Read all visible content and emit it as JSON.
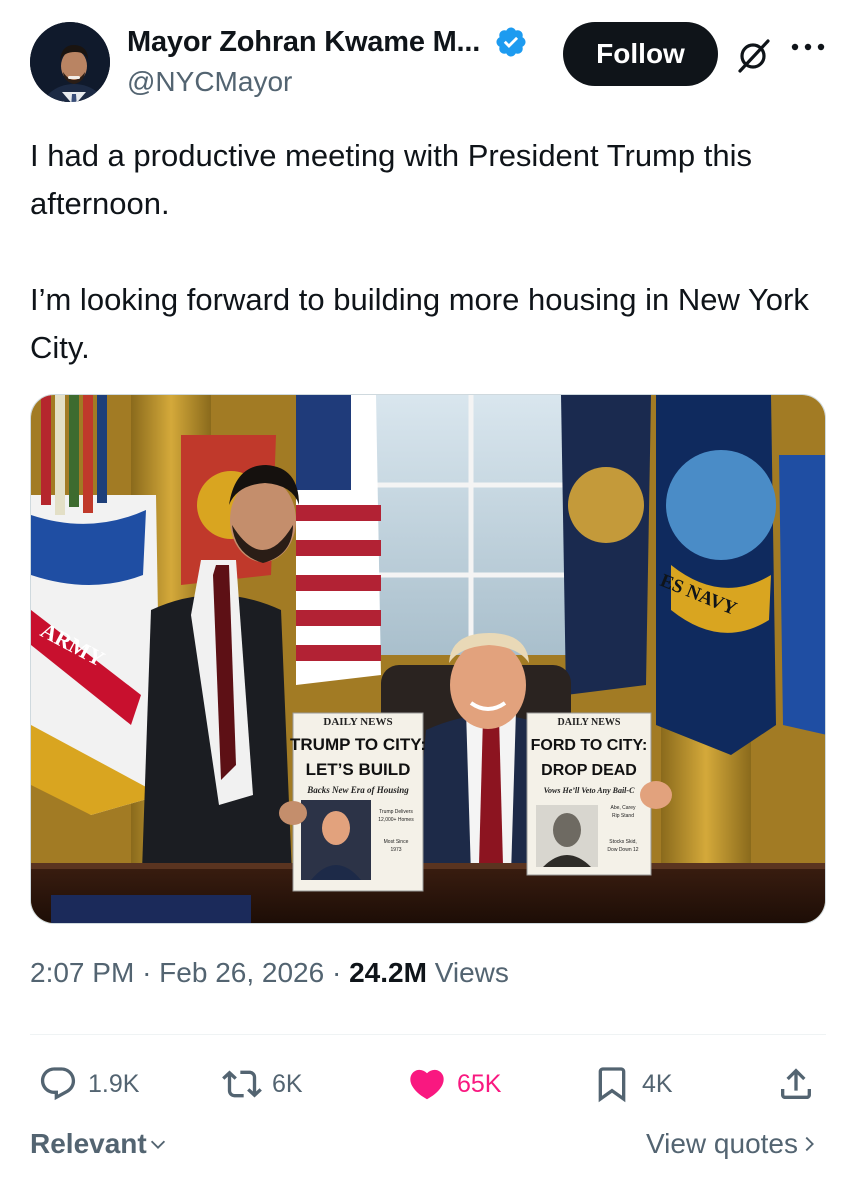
{
  "author": {
    "display_name": "Mayor Zohran Kwame M...",
    "handle": "@NYCMayor",
    "verified": true
  },
  "header": {
    "follow_label": "Follow",
    "icons": [
      "grok-icon",
      "more-icon"
    ]
  },
  "tweet": {
    "paragraphs": [
      "I had a productive meeting with President Trump this afternoon.",
      "I’m looking forward to building more housing in New York City."
    ]
  },
  "media": {
    "left_paper": {
      "masthead": "DAILY NEWS",
      "headline_1": "TRUMP TO CITY:",
      "headline_2": "LET’S BUILD",
      "subhead": "Backs New Era of Housing",
      "side_1": "Trump Delivers",
      "side_2": "12,000+ Homes",
      "side_3": "Most Since",
      "side_4": "1973"
    },
    "right_paper": {
      "masthead": "DAILY NEWS",
      "headline_1": "FORD TO CITY:",
      "headline_2": "DROP DEAD",
      "subhead": "Vows He’ll Veto Any Bail-C",
      "side_1": "Abe, Carey",
      "side_2": "Rip Stand",
      "side_3": "Stocks Skid,",
      "side_4": "Dow Down 12"
    },
    "flag_text_1": "ARMY",
    "flag_text_2": "ES NAVY"
  },
  "meta": {
    "time": "2:07 PM",
    "date": "Feb 26, 2026",
    "views_count": "24.2M",
    "views_label": "Views"
  },
  "actions": {
    "replies": "1.9K",
    "reposts": "6K",
    "likes": "65K",
    "bookmarks": "4K"
  },
  "footer": {
    "sort_label": "Relevant",
    "quotes_label": "View quotes"
  },
  "colors": {
    "text": "#0f1419",
    "secondary": "#536471",
    "verified": "#1d9bf0",
    "like": "#f91880"
  }
}
